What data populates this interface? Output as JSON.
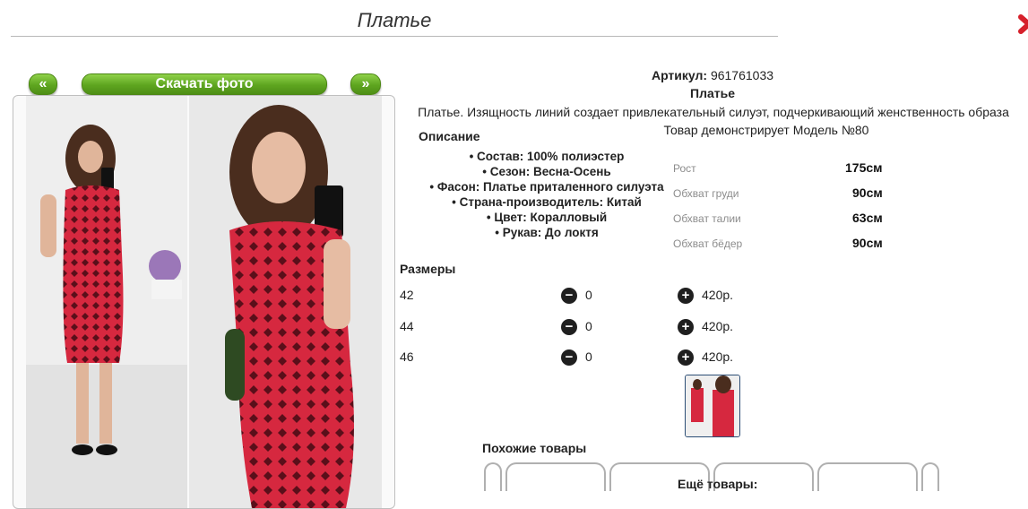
{
  "page": {
    "title": "Платье"
  },
  "gallery": {
    "prev_label": "«",
    "next_label": "»",
    "download_label": "Скачать фото"
  },
  "product": {
    "article_label": "Артикул:",
    "article_value": "961761033",
    "name": "Платье",
    "description": "Платье. Изящность линий создает привлекательный силуэт, подчеркивающий женственность образа",
    "model_note": "Товар демонстрирует Модель №80",
    "description_heading": "Описание",
    "attributes": [
      "Состав: 100% полиэстер",
      "Сезон: Весна-Осень",
      "Фасон: Платье приталенного силуэта",
      "Страна-производитель: Китай",
      "Цвет: Коралловый",
      "Рукав: До локтя"
    ],
    "measurements": [
      {
        "label": "Рост",
        "value": "175см"
      },
      {
        "label": "Обхват груди",
        "value": "90см"
      },
      {
        "label": "Обхват талии",
        "value": "63см"
      },
      {
        "label": "Обхват бёдер",
        "value": "90см"
      }
    ]
  },
  "sizes": {
    "heading": "Размеры",
    "rows": [
      {
        "size": "42",
        "qty": "0",
        "price": "420р."
      },
      {
        "size": "44",
        "qty": "0",
        "price": "420р."
      },
      {
        "size": "46",
        "qty": "0",
        "price": "420р."
      }
    ]
  },
  "similar": {
    "heading": "Похожие товары",
    "more": "Ещё товары:"
  },
  "colors": {
    "accent_green": "#6cb42b",
    "dress_red": "#d6283f",
    "close_red": "#d6202b"
  }
}
